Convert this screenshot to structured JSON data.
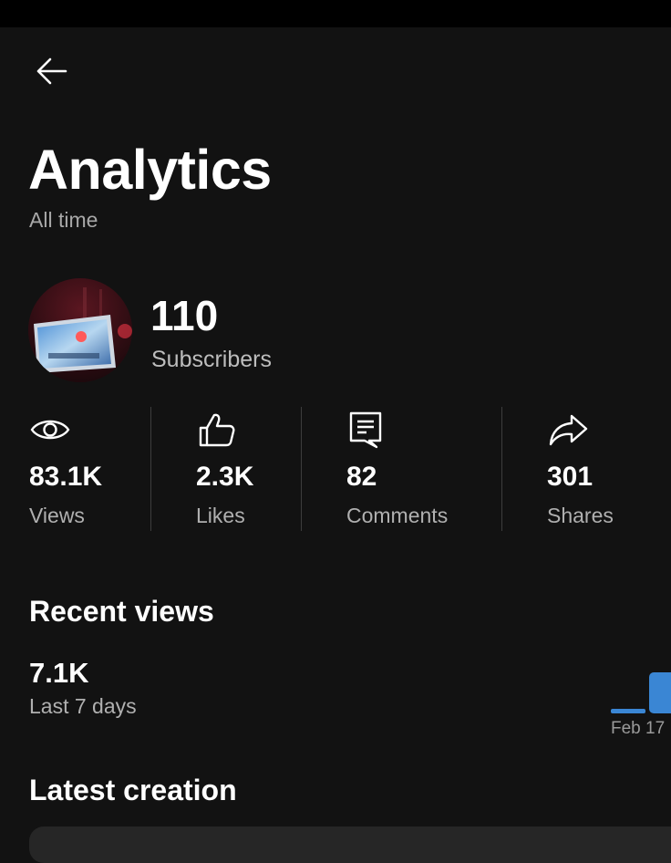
{
  "header": {
    "back_icon": "arrow-left-icon",
    "title": "Analytics",
    "subtitle": "All time"
  },
  "channel": {
    "subscriber_count": "110",
    "subscriber_label": "Subscribers"
  },
  "stats": [
    {
      "icon": "eye-icon",
      "value": "83.1K",
      "label": "Views"
    },
    {
      "icon": "thumbs-up-icon",
      "value": "2.3K",
      "label": "Likes"
    },
    {
      "icon": "comment-icon",
      "value": "82",
      "label": "Comments"
    },
    {
      "icon": "share-arrow-icon",
      "value": "301",
      "label": "Shares"
    }
  ],
  "recent_views": {
    "title": "Recent views",
    "value": "7.1K",
    "period": "Last 7 days",
    "chart_tick": "Feb 17",
    "bar_color": "#3a86d4"
  },
  "latest_creation": {
    "title": "Latest creation"
  },
  "colors": {
    "background": "#121212",
    "text": "#ffffff",
    "muted_text": "#b0b0b0",
    "accent": "#3a86d4"
  }
}
